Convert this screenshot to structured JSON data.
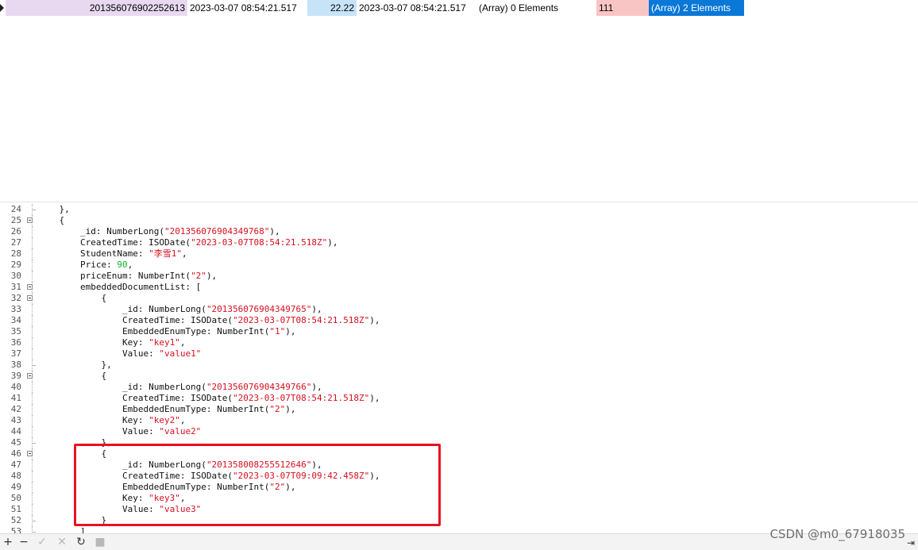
{
  "grid": {
    "row": {
      "id": "201356076902252613",
      "created_time": "2023-03-07 08:54:21.517",
      "price": "22.22",
      "updated_time": "2023-03-07 08:54:21.517",
      "array_a": "(Array) 0 Elements",
      "number": "111",
      "array_b": "(Array) 2 Elements"
    },
    "colors": {
      "id": "#e8d9f1",
      "price": "#c7e3f7",
      "number": "#f9c5c4",
      "selected": "#0a78d7"
    }
  },
  "editor": {
    "lines": [
      {
        "n": "24",
        "indent": "    ",
        "t": [
          [
            "p",
            "},"
          ]
        ],
        "fold": false,
        "end": true
      },
      {
        "n": "25",
        "indent": "    ",
        "t": [
          [
            "p",
            "{"
          ]
        ],
        "fold": true
      },
      {
        "n": "26",
        "indent": "        ",
        "t": [
          [
            "p",
            "_id: NumberLong("
          ],
          [
            "s",
            "\"201356076904349768\""
          ],
          [
            "p",
            "),"
          ]
        ]
      },
      {
        "n": "27",
        "indent": "        ",
        "t": [
          [
            "p",
            "CreatedTime: ISODate("
          ],
          [
            "s",
            "\"2023-03-07T08:54:21.518Z\""
          ],
          [
            "p",
            "),"
          ]
        ]
      },
      {
        "n": "28",
        "indent": "        ",
        "t": [
          [
            "p",
            "StudentName: "
          ],
          [
            "s",
            "\"李雪1\""
          ],
          [
            "p",
            ","
          ]
        ]
      },
      {
        "n": "29",
        "indent": "        ",
        "t": [
          [
            "p",
            "Price: "
          ],
          [
            "g",
            "90"
          ],
          [
            "p",
            ","
          ]
        ]
      },
      {
        "n": "30",
        "indent": "        ",
        "t": [
          [
            "p",
            "priceEnum: NumberInt("
          ],
          [
            "s",
            "\"2\""
          ],
          [
            "p",
            "),"
          ]
        ]
      },
      {
        "n": "31",
        "indent": "        ",
        "t": [
          [
            "p",
            "embeddedDocumentList: ["
          ]
        ],
        "fold": true
      },
      {
        "n": "32",
        "indent": "            ",
        "t": [
          [
            "p",
            "{"
          ]
        ],
        "fold": true
      },
      {
        "n": "33",
        "indent": "                ",
        "t": [
          [
            "p",
            "_id: NumberLong("
          ],
          [
            "s",
            "\"201356076904349765\""
          ],
          [
            "p",
            "),"
          ]
        ]
      },
      {
        "n": "34",
        "indent": "                ",
        "t": [
          [
            "p",
            "CreatedTime: ISODate("
          ],
          [
            "s",
            "\"2023-03-07T08:54:21.518Z\""
          ],
          [
            "p",
            "),"
          ]
        ]
      },
      {
        "n": "35",
        "indent": "                ",
        "t": [
          [
            "p",
            "EmbeddedEnumType: NumberInt("
          ],
          [
            "s",
            "\"1\""
          ],
          [
            "p",
            "),"
          ]
        ]
      },
      {
        "n": "36",
        "indent": "                ",
        "t": [
          [
            "p",
            "Key: "
          ],
          [
            "s",
            "\"key1\""
          ],
          [
            "p",
            ","
          ]
        ]
      },
      {
        "n": "37",
        "indent": "                ",
        "t": [
          [
            "p",
            "Value: "
          ],
          [
            "s",
            "\"value1\""
          ]
        ]
      },
      {
        "n": "38",
        "indent": "            ",
        "t": [
          [
            "p",
            "},"
          ]
        ],
        "end": true
      },
      {
        "n": "39",
        "indent": "            ",
        "t": [
          [
            "p",
            "{"
          ]
        ],
        "fold": true
      },
      {
        "n": "40",
        "indent": "                ",
        "t": [
          [
            "p",
            "_id: NumberLong("
          ],
          [
            "s",
            "\"201356076904349766\""
          ],
          [
            "p",
            "),"
          ]
        ]
      },
      {
        "n": "41",
        "indent": "                ",
        "t": [
          [
            "p",
            "CreatedTime: ISODate("
          ],
          [
            "s",
            "\"2023-03-07T08:54:21.518Z\""
          ],
          [
            "p",
            "),"
          ]
        ]
      },
      {
        "n": "42",
        "indent": "                ",
        "t": [
          [
            "p",
            "EmbeddedEnumType: NumberInt("
          ],
          [
            "s",
            "\"2\""
          ],
          [
            "p",
            "),"
          ]
        ]
      },
      {
        "n": "43",
        "indent": "                ",
        "t": [
          [
            "p",
            "Key: "
          ],
          [
            "s",
            "\"key2\""
          ],
          [
            "p",
            ","
          ]
        ]
      },
      {
        "n": "44",
        "indent": "                ",
        "t": [
          [
            "p",
            "Value: "
          ],
          [
            "s",
            "\"value2\""
          ]
        ]
      },
      {
        "n": "45",
        "indent": "            ",
        "t": [
          [
            "p",
            "},"
          ]
        ],
        "end": true
      },
      {
        "n": "46",
        "indent": "            ",
        "t": [
          [
            "p",
            "{"
          ]
        ],
        "fold": true
      },
      {
        "n": "47",
        "indent": "                ",
        "t": [
          [
            "p",
            "_id: NumberLong("
          ],
          [
            "s",
            "\"201358008255512646\""
          ],
          [
            "p",
            "),"
          ]
        ]
      },
      {
        "n": "48",
        "indent": "                ",
        "t": [
          [
            "p",
            "CreatedTime: ISODate("
          ],
          [
            "s",
            "\"2023-03-07T09:09:42.458Z\""
          ],
          [
            "p",
            "),"
          ]
        ]
      },
      {
        "n": "49",
        "indent": "                ",
        "t": [
          [
            "p",
            "EmbeddedEnumType: NumberInt("
          ],
          [
            "s",
            "\"2\""
          ],
          [
            "p",
            "),"
          ]
        ]
      },
      {
        "n": "50",
        "indent": "                ",
        "t": [
          [
            "p",
            "Key: "
          ],
          [
            "s",
            "\"key3\""
          ],
          [
            "p",
            ","
          ]
        ]
      },
      {
        "n": "51",
        "indent": "                ",
        "t": [
          [
            "p",
            "Value: "
          ],
          [
            "s",
            "\"value3\""
          ]
        ]
      },
      {
        "n": "52",
        "indent": "            ",
        "t": [
          [
            "p",
            "}"
          ]
        ],
        "end": true
      },
      {
        "n": "53",
        "indent": "        ",
        "t": [
          [
            "p",
            "]"
          ]
        ],
        "end": true
      }
    ],
    "colors": {
      "string": "#d4101f",
      "number": "#0cb524",
      "highlight_box": "#e81123"
    }
  },
  "toolbar": {
    "add_icon": "plus-icon",
    "remove_icon": "minus-icon",
    "apply_icon": "check-icon",
    "discard_icon": "x-icon",
    "refresh_icon": "refresh-icon",
    "stop_icon": "stop-icon",
    "end_icon": "last-record-icon"
  },
  "watermark": "CSDN @m0_67918035"
}
